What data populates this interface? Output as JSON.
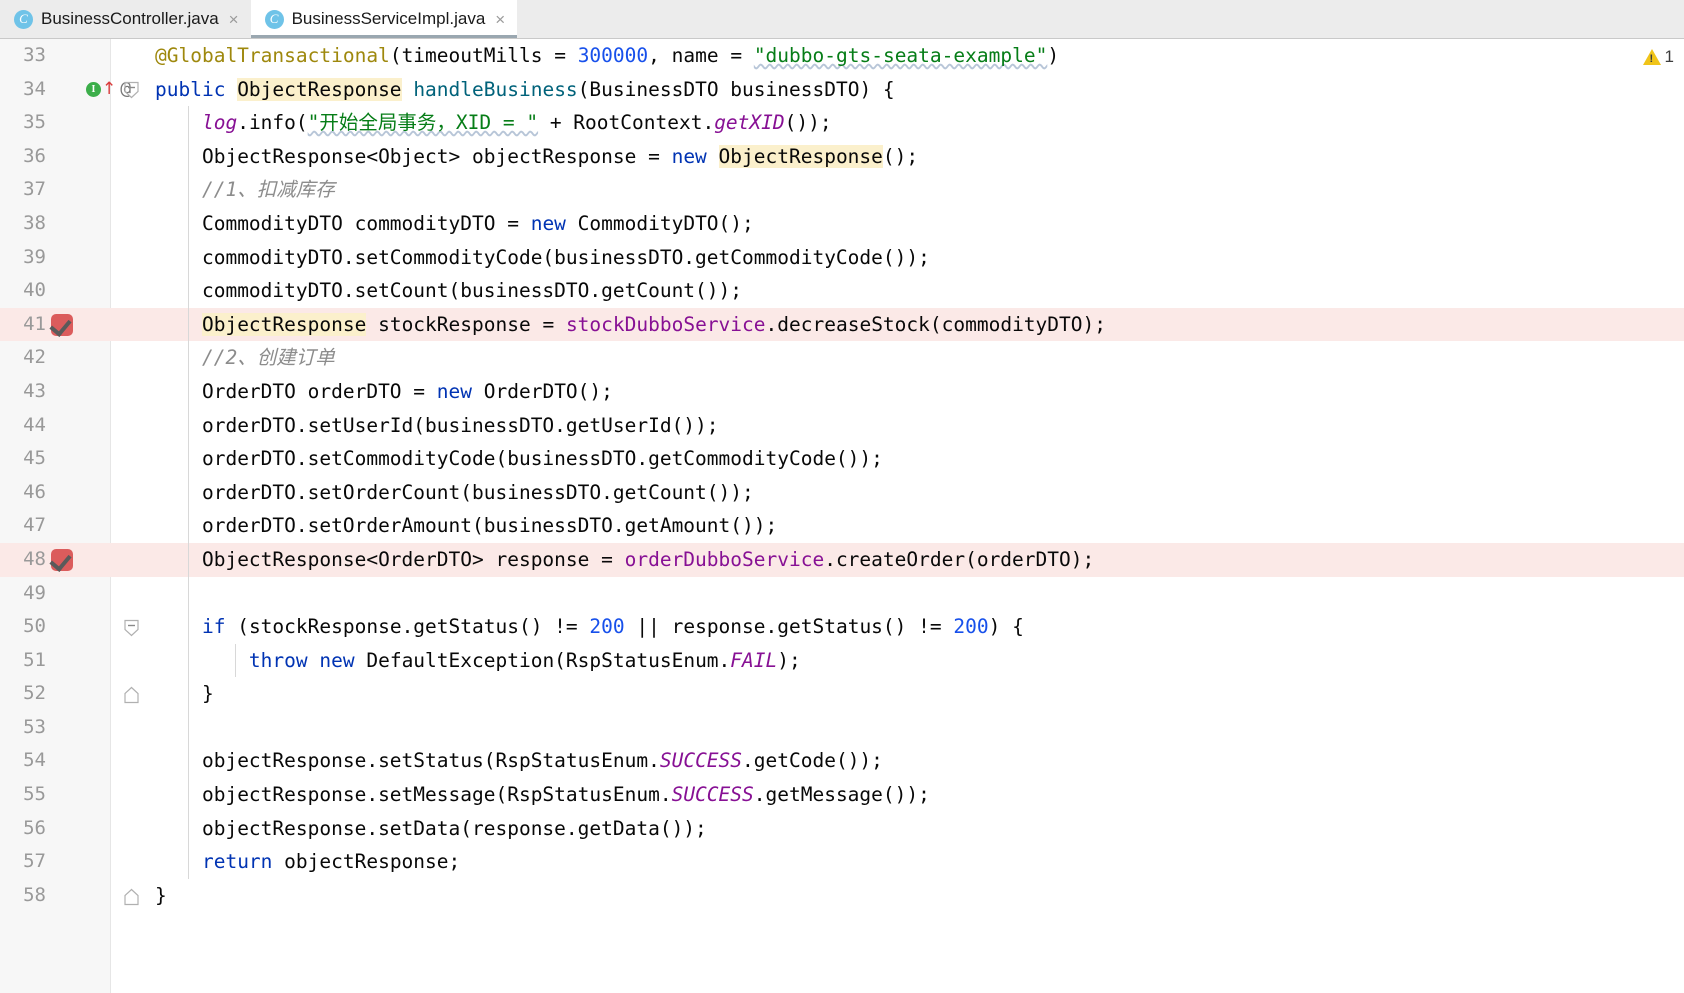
{
  "tabs": [
    {
      "label": "BusinessController.java",
      "icon": "java-class-icon",
      "close": "×",
      "active": false
    },
    {
      "label": "BusinessServiceImpl.java",
      "icon": "java-class-icon",
      "close": "×",
      "active": true
    }
  ],
  "editor": {
    "warning_count": "1",
    "first_line": 33,
    "lines": [
      {
        "no": "33",
        "bp": false,
        "run": false,
        "fold": "none",
        "tokens": [
          {
            "t": "@GlobalTransactional",
            "c": "ann"
          },
          {
            "t": "(",
            "c": ""
          },
          {
            "t": "timeoutMills",
            "c": ""
          },
          {
            "t": " = ",
            "c": ""
          },
          {
            "t": "300000",
            "c": "num"
          },
          {
            "t": ", name = ",
            "c": ""
          },
          {
            "t": "\"dubbo-gts-seata-example\"",
            "c": "str sq"
          },
          {
            "t": ")",
            "c": ""
          }
        ],
        "indent": 0
      },
      {
        "no": "34",
        "bp": false,
        "run": true,
        "fold": "collapse",
        "tokens": [
          {
            "t": "public ",
            "c": "kw"
          },
          {
            "t": "ObjectResponse",
            "c": "hl"
          },
          {
            "t": " ",
            "c": ""
          },
          {
            "t": "handleBusiness",
            "c": "mth"
          },
          {
            "t": "(BusinessDTO businessDTO) {",
            "c": ""
          }
        ],
        "indent": 0
      },
      {
        "no": "35",
        "bp": false,
        "run": false,
        "fold": "none",
        "tokens": [
          {
            "t": "log",
            "c": "fldi"
          },
          {
            "t": ".info(",
            "c": ""
          },
          {
            "t": "\"开始全局事务，XID = \"",
            "c": "str sq"
          },
          {
            "t": " + RootContext.",
            "c": ""
          },
          {
            "t": "getXID",
            "c": "sta"
          },
          {
            "t": "());",
            "c": ""
          }
        ],
        "indent": 1
      },
      {
        "no": "36",
        "bp": false,
        "run": false,
        "fold": "none",
        "tokens": [
          {
            "t": "ObjectResponse<Object> objectResponse = ",
            "c": ""
          },
          {
            "t": "new ",
            "c": "kw"
          },
          {
            "t": "ObjectResponse",
            "c": "hl"
          },
          {
            "t": "();",
            "c": ""
          }
        ],
        "indent": 1
      },
      {
        "no": "37",
        "bp": false,
        "run": false,
        "fold": "none",
        "tokens": [
          {
            "t": "//1、扣减库存",
            "c": "cmt"
          }
        ],
        "indent": 1
      },
      {
        "no": "38",
        "bp": false,
        "run": false,
        "fold": "none",
        "tokens": [
          {
            "t": "CommodityDTO commodityDTO = ",
            "c": ""
          },
          {
            "t": "new ",
            "c": "kw"
          },
          {
            "t": "CommodityDTO();",
            "c": ""
          }
        ],
        "indent": 1
      },
      {
        "no": "39",
        "bp": false,
        "run": false,
        "fold": "none",
        "tokens": [
          {
            "t": "commodityDTO.setCommodityCode(businessDTO.getCommodityCode());",
            "c": ""
          }
        ],
        "indent": 1
      },
      {
        "no": "40",
        "bp": false,
        "run": false,
        "fold": "none",
        "tokens": [
          {
            "t": "commodityDTO.setCount(businessDTO.getCount());",
            "c": ""
          }
        ],
        "indent": 1
      },
      {
        "no": "41",
        "bp": true,
        "run": false,
        "fold": "none",
        "tokens": [
          {
            "t": "ObjectResponse",
            "c": "hl"
          },
          {
            "t": " stockResponse = ",
            "c": ""
          },
          {
            "t": "stockDubboService",
            "c": "fld"
          },
          {
            "t": ".decreaseStock(commodityDTO);",
            "c": ""
          }
        ],
        "indent": 1
      },
      {
        "no": "42",
        "bp": false,
        "run": false,
        "fold": "none",
        "tokens": [
          {
            "t": "//2、创建订单",
            "c": "cmt"
          }
        ],
        "indent": 1
      },
      {
        "no": "43",
        "bp": false,
        "run": false,
        "fold": "none",
        "tokens": [
          {
            "t": "OrderDTO orderDTO = ",
            "c": ""
          },
          {
            "t": "new ",
            "c": "kw"
          },
          {
            "t": "OrderDTO();",
            "c": ""
          }
        ],
        "indent": 1
      },
      {
        "no": "44",
        "bp": false,
        "run": false,
        "fold": "none",
        "tokens": [
          {
            "t": "orderDTO.setUserId(businessDTO.getUserId());",
            "c": ""
          }
        ],
        "indent": 1
      },
      {
        "no": "45",
        "bp": false,
        "run": false,
        "fold": "none",
        "tokens": [
          {
            "t": "orderDTO.setCommodityCode(businessDTO.getCommodityCode());",
            "c": ""
          }
        ],
        "indent": 1
      },
      {
        "no": "46",
        "bp": false,
        "run": false,
        "fold": "none",
        "tokens": [
          {
            "t": "orderDTO.setOrderCount(businessDTO.getCount());",
            "c": ""
          }
        ],
        "indent": 1
      },
      {
        "no": "47",
        "bp": false,
        "run": false,
        "fold": "none",
        "tokens": [
          {
            "t": "orderDTO.setOrderAmount(businessDTO.getAmount());",
            "c": ""
          }
        ],
        "indent": 1
      },
      {
        "no": "48",
        "bp": true,
        "run": false,
        "fold": "none",
        "tokens": [
          {
            "t": "ObjectResponse<OrderDTO> response = ",
            "c": ""
          },
          {
            "t": "orderDubboService",
            "c": "fld"
          },
          {
            "t": ".createOrder(orderDTO);",
            "c": ""
          }
        ],
        "indent": 1
      },
      {
        "no": "49",
        "bp": false,
        "run": false,
        "fold": "none",
        "tokens": [],
        "indent": 1
      },
      {
        "no": "50",
        "bp": false,
        "run": false,
        "fold": "collapse",
        "tokens": [
          {
            "t": "if ",
            "c": "kw"
          },
          {
            "t": "(stockResponse.getStatus() != ",
            "c": ""
          },
          {
            "t": "200",
            "c": "num"
          },
          {
            "t": " || response.getStatus() != ",
            "c": ""
          },
          {
            "t": "200",
            "c": "num"
          },
          {
            "t": ") {",
            "c": ""
          }
        ],
        "indent": 1
      },
      {
        "no": "51",
        "bp": false,
        "run": false,
        "fold": "none",
        "tokens": [
          {
            "t": "throw ",
            "c": "kw"
          },
          {
            "t": "new ",
            "c": "kw"
          },
          {
            "t": "DefaultException(RspStatusEnum.",
            "c": ""
          },
          {
            "t": "FAIL",
            "c": "sta"
          },
          {
            "t": ");",
            "c": ""
          }
        ],
        "indent": 2
      },
      {
        "no": "52",
        "bp": false,
        "run": false,
        "fold": "end",
        "tokens": [
          {
            "t": "}",
            "c": ""
          }
        ],
        "indent": 1
      },
      {
        "no": "53",
        "bp": false,
        "run": false,
        "fold": "none",
        "tokens": [],
        "indent": 1
      },
      {
        "no": "54",
        "bp": false,
        "run": false,
        "fold": "none",
        "tokens": [
          {
            "t": "objectResponse.setStatus(RspStatusEnum.",
            "c": ""
          },
          {
            "t": "SUCCESS",
            "c": "sta"
          },
          {
            "t": ".getCode());",
            "c": ""
          }
        ],
        "indent": 1
      },
      {
        "no": "55",
        "bp": false,
        "run": false,
        "fold": "none",
        "tokens": [
          {
            "t": "objectResponse.setMessage(RspStatusEnum.",
            "c": ""
          },
          {
            "t": "SUCCESS",
            "c": "sta"
          },
          {
            "t": ".getMessage());",
            "c": ""
          }
        ],
        "indent": 1
      },
      {
        "no": "56",
        "bp": false,
        "run": false,
        "fold": "none",
        "tokens": [
          {
            "t": "objectResponse.setData(response.getData());",
            "c": ""
          }
        ],
        "indent": 1
      },
      {
        "no": "57",
        "bp": false,
        "run": false,
        "fold": "none",
        "tokens": [
          {
            "t": "return ",
            "c": "kw"
          },
          {
            "t": "objectResponse;",
            "c": ""
          }
        ],
        "indent": 1
      },
      {
        "no": "58",
        "bp": false,
        "run": false,
        "fold": "end",
        "tokens": [
          {
            "t": "}",
            "c": ""
          }
        ],
        "indent": 0
      }
    ]
  }
}
